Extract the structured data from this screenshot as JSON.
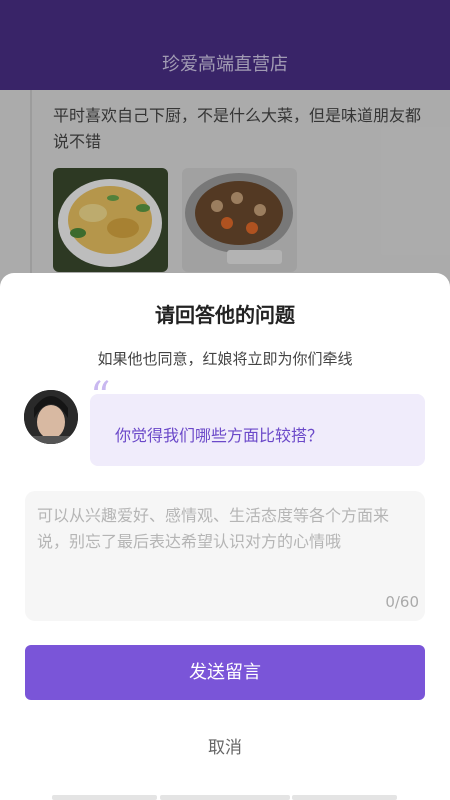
{
  "header": {
    "title": "珍爱高端直营店"
  },
  "post": {
    "text": "平时喜欢自己下厨，不是什么大菜，但是味道朋友都说不错",
    "photos": [
      "omelette-photo",
      "rice-cooker-photo"
    ]
  },
  "dialog": {
    "title": "请回答他的问题",
    "subtitle": "如果他也同意，红娘将立即为你们牵线",
    "quote_mark": "“",
    "question": "你觉得我们哪些方面比较搭？",
    "input_placeholder": "可以从兴趣爱好、感情观、生活态度等各个方面来说，别忘了最后表达希望认识对方的心情哦",
    "input_value": "",
    "counter": "0/60",
    "send_label": "发送留言",
    "cancel_label": "取消"
  },
  "colors": {
    "header_bg": "#4a2f86",
    "accent": "#7a55d8",
    "question_bg": "#f0ecfb",
    "question_text": "#6b49c9"
  },
  "icons": [
    "avatar-image"
  ]
}
